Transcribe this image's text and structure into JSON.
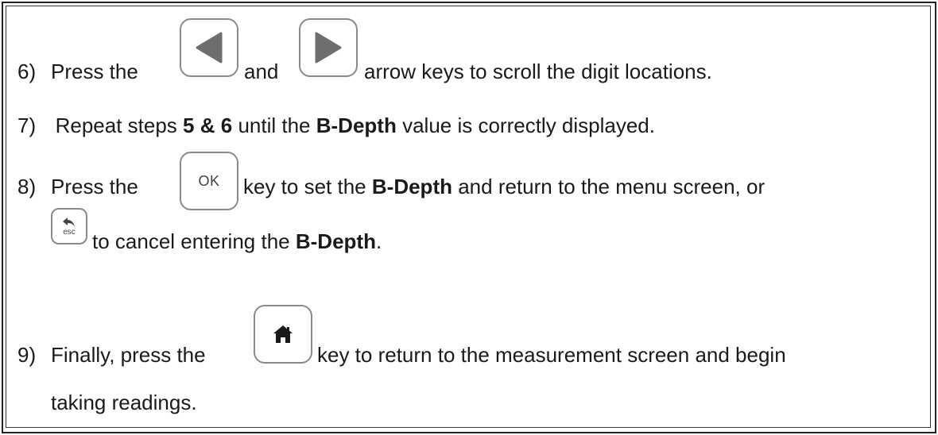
{
  "steps": {
    "s6": {
      "number": "6)",
      "pre": "Press the",
      "mid": "and",
      "post": "arrow keys to scroll the digit locations."
    },
    "s7": {
      "number": "7)",
      "pre": "Repeat steps",
      "bold1": "5 & 6",
      "mid": "until the",
      "bold2": "B-Depth",
      "post": "value is correctly displayed."
    },
    "s8": {
      "number": "8)",
      "pre": "Press the",
      "mid": "key to set the",
      "bold1": "B-Depth",
      "post": "and return to the menu screen, or",
      "line2_pre": "to cancel entering the",
      "line2_bold": "B-Depth",
      "line2_post": "."
    },
    "s9": {
      "number": "9)",
      "pre": "Finally, press the",
      "post": "key to return to the measurement screen and begin",
      "line2": "taking readings."
    }
  },
  "keys": {
    "ok_label": "OK",
    "esc_label": "esc",
    "left_icon": "left-arrow-icon",
    "right_icon": "right-arrow-icon",
    "home_icon": "home-icon",
    "back_icon": "back-arrow-icon"
  },
  "colors": {
    "key_border": "#8a8a8a",
    "arrow_fill": "#6e6e6e",
    "text": "#1a1a1a"
  }
}
